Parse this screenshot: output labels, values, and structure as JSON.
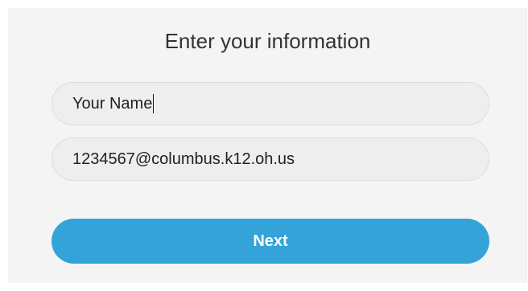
{
  "form": {
    "title": "Enter your information",
    "name_field": {
      "value": "Your Name"
    },
    "email_field": {
      "value": "1234567@columbus.k12.oh.us"
    },
    "next_label": "Next"
  },
  "colors": {
    "accent": "#33a3d9",
    "card_background": "#f4f4f4",
    "field_background": "#eeeeee"
  }
}
